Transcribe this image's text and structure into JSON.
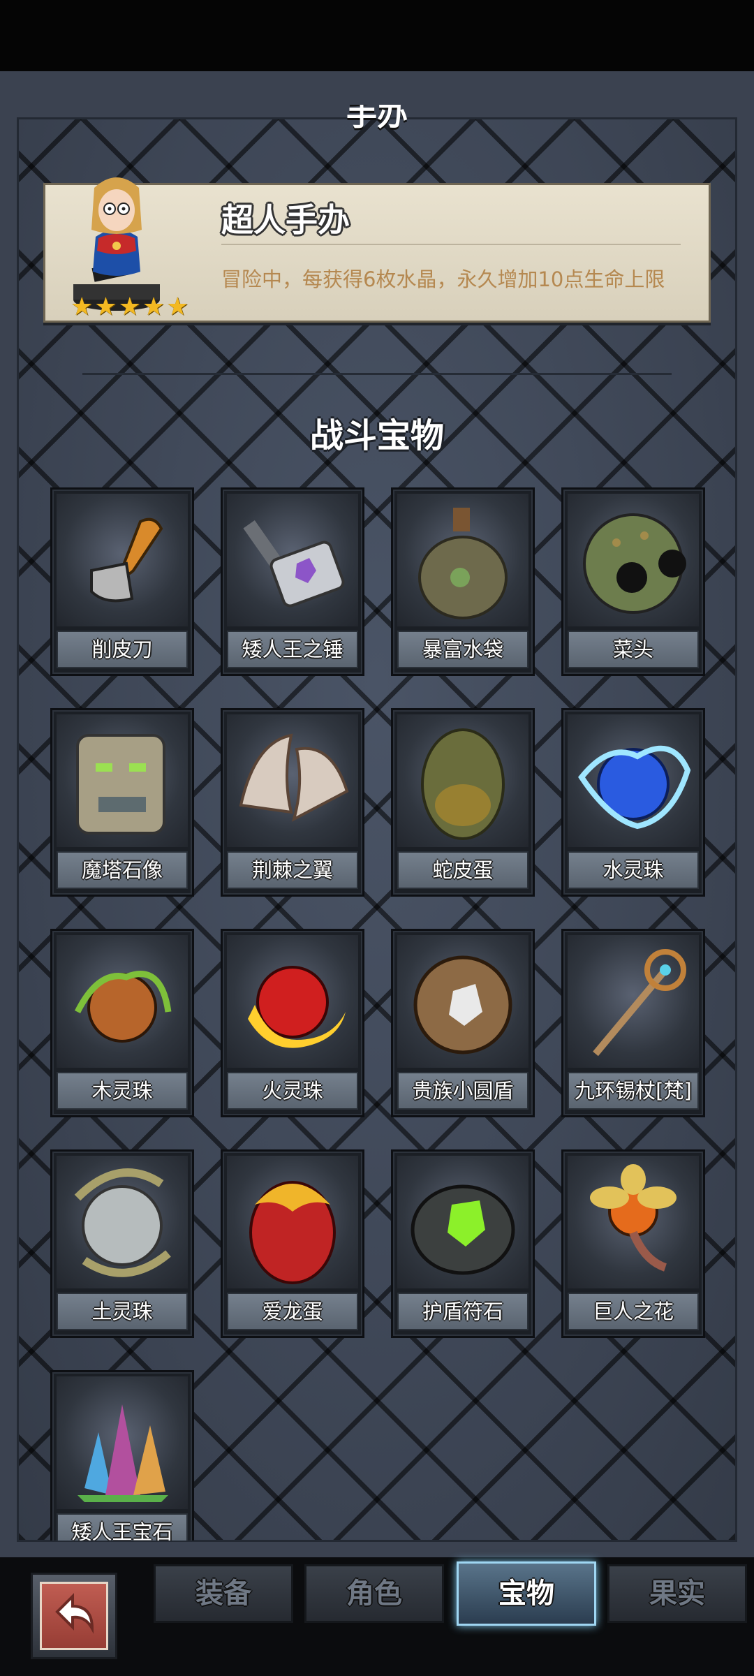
{
  "header": {
    "cut_title": "手办"
  },
  "figure": {
    "name": "超人手办",
    "description": "冒险中，每获得6枚水晶，永久增加10点生命上限",
    "stars": 5
  },
  "section_title": "战斗宝物",
  "items": [
    {
      "label": "削皮刀",
      "icon": "peeler-icon"
    },
    {
      "label": "矮人王之锤",
      "icon": "hammer-icon"
    },
    {
      "label": "暴富水袋",
      "icon": "water-pouch-icon"
    },
    {
      "label": "菜头",
      "icon": "cabbage-head-icon"
    },
    {
      "label": "魔塔石像",
      "icon": "stone-statue-icon"
    },
    {
      "label": "荆棘之翼",
      "icon": "thorn-wings-icon"
    },
    {
      "label": "蛇皮蛋",
      "icon": "snake-egg-icon"
    },
    {
      "label": "水灵珠",
      "icon": "water-orb-icon"
    },
    {
      "label": "木灵珠",
      "icon": "wood-orb-icon"
    },
    {
      "label": "火灵珠",
      "icon": "fire-orb-icon"
    },
    {
      "label": "贵族小圆盾",
      "icon": "round-shield-icon"
    },
    {
      "label": "九环锡杖[梵]",
      "icon": "staff-icon"
    },
    {
      "label": "土灵珠",
      "icon": "earth-orb-icon"
    },
    {
      "label": "爱龙蛋",
      "icon": "dragon-egg-icon"
    },
    {
      "label": "护盾符石",
      "icon": "rune-stone-icon"
    },
    {
      "label": "巨人之花",
      "icon": "giant-flower-icon"
    },
    {
      "label": "矮人王宝石",
      "icon": "crystal-gem-icon"
    }
  ],
  "tabs": [
    {
      "label": "装备",
      "active": false
    },
    {
      "label": "角色",
      "active": false
    },
    {
      "label": "宝物",
      "active": true
    },
    {
      "label": "果实",
      "active": false
    }
  ],
  "colors": {
    "star": "#f3b922",
    "description": "#b58850",
    "active_tab_glow": "#7fc9ee",
    "back_button": "#b04e44"
  }
}
